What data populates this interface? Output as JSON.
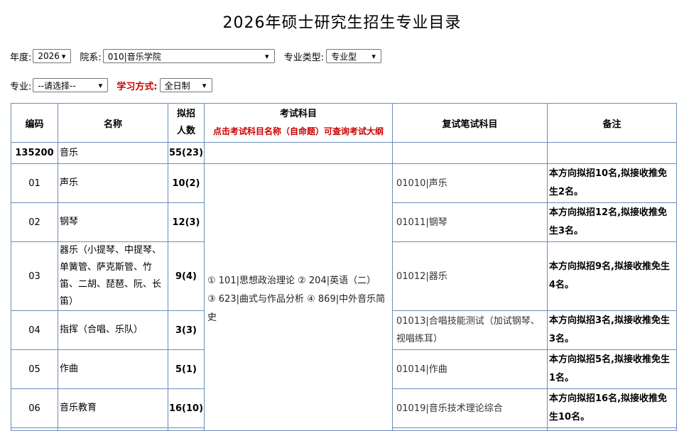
{
  "page": {
    "title": "2026年硕士研究生招生专业目录"
  },
  "filters": {
    "year_label": "年度:",
    "year_value": "2026",
    "dept_label": "院系:",
    "dept_value": "010|音乐学院",
    "type_label": "专业类型:",
    "type_value": "专业型",
    "major_label": "专业:",
    "major_value": "--请选择--",
    "mode_label": "学习方式:",
    "mode_value": "全日制"
  },
  "table": {
    "headers": {
      "code": "编码",
      "name": "名称",
      "plan_1": "拟招",
      "plan_2": "人数",
      "exam": "考试科目",
      "exam_note": "点击考试科目名称（自命题）可查询考试大纲",
      "retest": "复试笔试科目",
      "remark": "备注"
    },
    "group": {
      "code": "135200",
      "name": "音乐",
      "plan": "55(23)"
    },
    "exam_subjects": {
      "line1": "① 101|思想政治理论  ② 204|英语（二）",
      "line2": "③ 623|曲式与作品分析  ④ 869|中外音乐简史"
    },
    "rows": [
      {
        "code": "01",
        "name": "声乐",
        "plan": "10(2)",
        "retest": "01010|声乐",
        "remark": "本方向拟招10名,拟接收推免生2名。"
      },
      {
        "code": "02",
        "name": "钢琴",
        "plan": "12(3)",
        "retest": "01011|钢琴",
        "remark": "本方向拟招12名,拟接收推免生3名。"
      },
      {
        "code": "03",
        "name": "器乐（小提琴、中提琴、单簧管、萨克斯管、竹笛、二胡、琵琶、阮、长笛）",
        "plan": "9(4)",
        "retest": "01012|器乐",
        "remark": "本方向拟招9名,拟接收推免生4名。"
      },
      {
        "code": "04",
        "name": "指挥（合唱、乐队）",
        "plan": "3(3)",
        "retest": "01013|合唱技能测试（加试钢琴、视唱练耳）",
        "remark": "本方向拟招3名,拟接收推免生3名。"
      },
      {
        "code": "05",
        "name": "作曲",
        "plan": "5(1)",
        "retest": "01014|作曲",
        "remark": "本方向拟招5名,拟接收推免生1名。"
      },
      {
        "code": "06",
        "name": "音乐教育",
        "plan": "16(10)",
        "retest": "01019|音乐技术理论综合",
        "remark": "本方向拟招16名,拟接收推免生10名。"
      }
    ]
  }
}
